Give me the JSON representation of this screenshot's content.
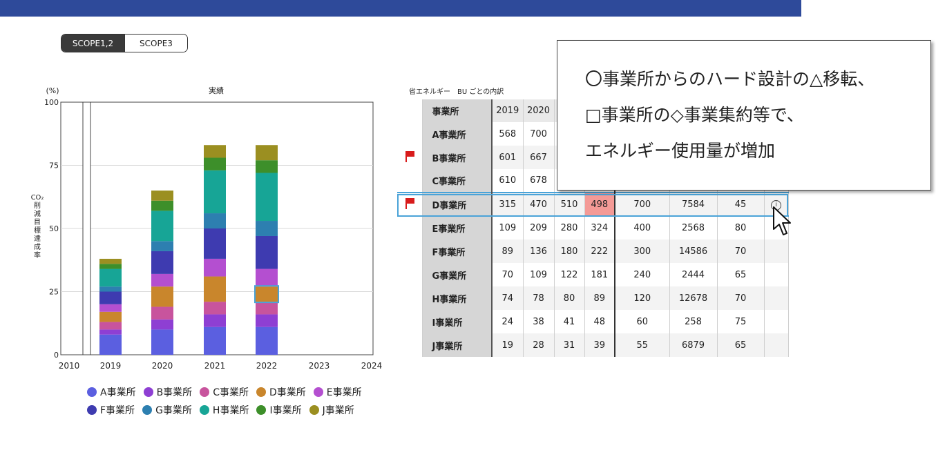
{
  "scope_toggle": {
    "active": "SCOPE1,2",
    "inactive": "SCOPE3"
  },
  "chart_data": {
    "type": "bar",
    "stacked": true,
    "title": "実績",
    "yunit": "(%)",
    "ylabel": "CO₂削減目標達成率",
    "ylim": [
      0,
      100
    ],
    "yticks": [
      0,
      25,
      50,
      75,
      100
    ],
    "xticks": [
      "2010",
      "2019",
      "2020",
      "2021",
      "2022",
      "2023",
      "2024"
    ],
    "categories": [
      "2019",
      "2020",
      "2021",
      "2022"
    ],
    "grid": true,
    "legend_position": "bottom",
    "series": [
      {
        "name": "A事業所",
        "color": "#5b5fe0",
        "values": [
          8,
          10,
          11,
          11
        ]
      },
      {
        "name": "B事業所",
        "color": "#8e3fd3",
        "values": [
          2,
          4,
          5,
          5
        ]
      },
      {
        "name": "C事業所",
        "color": "#c8549d",
        "values": [
          3,
          5,
          5,
          5
        ]
      },
      {
        "name": "D事業所",
        "color": "#c9862c",
        "values": [
          4,
          8,
          10,
          6
        ]
      },
      {
        "name": "E事業所",
        "color": "#b44fd0",
        "values": [
          3,
          5,
          7,
          7
        ]
      },
      {
        "name": "F事業所",
        "color": "#3e3bb0",
        "values": [
          5,
          9,
          12,
          13
        ]
      },
      {
        "name": "G事業所",
        "color": "#2d7fb0",
        "values": [
          2,
          4,
          6,
          6
        ]
      },
      {
        "name": "H事業所",
        "color": "#17a596",
        "values": [
          7,
          12,
          17,
          19
        ]
      },
      {
        "name": "I事業所",
        "color": "#3d8f2a",
        "values": [
          2,
          4,
          5,
          5
        ]
      },
      {
        "name": "J事業所",
        "color": "#9b8f21",
        "values": [
          2,
          4,
          5,
          6
        ]
      }
    ]
  },
  "table": {
    "title": "省エネルギー　BU ごとの内訳",
    "headers": [
      "事業所",
      "2019",
      "2020",
      "",
      "",
      "",
      "",
      "",
      ""
    ],
    "rows": [
      {
        "flag": false,
        "name": "A事業所",
        "values": [
          "568",
          "700",
          "",
          "",
          "",
          "",
          ""
        ]
      },
      {
        "flag": true,
        "name": "B事業所",
        "values": [
          "601",
          "667",
          "",
          "",
          "",
          "",
          ""
        ]
      },
      {
        "flag": false,
        "name": "C事業所",
        "values": [
          "610",
          "678",
          "",
          "",
          "",
          "",
          ""
        ]
      },
      {
        "flag": true,
        "name": "D事業所",
        "values": [
          "315",
          "470",
          "510",
          "498",
          "700",
          "7584",
          "45"
        ]
      },
      {
        "flag": false,
        "name": "E事業所",
        "values": [
          "109",
          "209",
          "280",
          "324",
          "400",
          "2568",
          "80"
        ]
      },
      {
        "flag": false,
        "name": "F事業所",
        "values": [
          "89",
          "136",
          "180",
          "222",
          "300",
          "14586",
          "70"
        ]
      },
      {
        "flag": false,
        "name": "G事業所",
        "values": [
          "70",
          "109",
          "122",
          "181",
          "240",
          "2444",
          "65"
        ]
      },
      {
        "flag": false,
        "name": "H事業所",
        "values": [
          "74",
          "78",
          "80",
          "89",
          "120",
          "12678",
          "70"
        ]
      },
      {
        "flag": false,
        "name": "I事業所",
        "values": [
          "24",
          "38",
          "41",
          "48",
          "60",
          "258",
          "75"
        ]
      },
      {
        "flag": false,
        "name": "J事業所",
        "values": [
          "19",
          "28",
          "31",
          "39",
          "55",
          "6879",
          "65"
        ]
      }
    ],
    "highlight_color": "#f49a96",
    "selected_row": "D事業所",
    "info_icon": "i"
  },
  "callout": {
    "lines": [
      "〇事業所からのハード設計の△移転、",
      "□事業所の◇事業集約等で、",
      "エネルギー使用量が増加"
    ]
  }
}
